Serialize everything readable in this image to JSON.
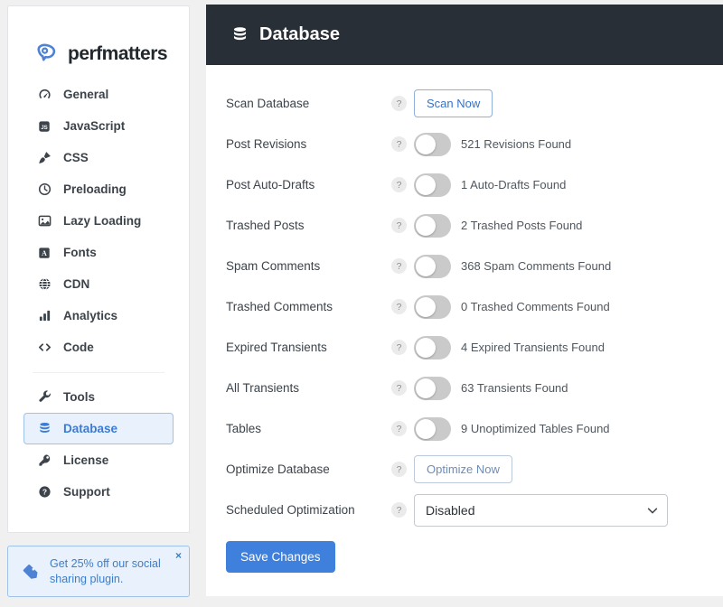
{
  "brand": {
    "name": "perfmatters"
  },
  "sidebar": {
    "items": [
      {
        "label": "General"
      },
      {
        "label": "JavaScript"
      },
      {
        "label": "CSS"
      },
      {
        "label": "Preloading"
      },
      {
        "label": "Lazy Loading"
      },
      {
        "label": "Fonts"
      },
      {
        "label": "CDN"
      },
      {
        "label": "Analytics"
      },
      {
        "label": "Code"
      }
    ],
    "items_secondary": [
      {
        "label": "Tools"
      },
      {
        "label": "Database",
        "active": true
      },
      {
        "label": "License"
      },
      {
        "label": "Support"
      }
    ],
    "promo": {
      "text": "Get 25% off our social sharing plugin.",
      "close": "×"
    }
  },
  "header": {
    "title": "Database"
  },
  "ui": {
    "help_glyph": "?"
  },
  "settings": {
    "rows": [
      {
        "label": "Scan Database",
        "control": "button",
        "button_label": "Scan Now"
      },
      {
        "label": "Post Revisions",
        "control": "toggle",
        "state": "off",
        "status": "521 Revisions Found"
      },
      {
        "label": "Post Auto-Drafts",
        "control": "toggle",
        "state": "off",
        "status": "1 Auto-Drafts Found"
      },
      {
        "label": "Trashed Posts",
        "control": "toggle",
        "state": "off",
        "status": "2 Trashed Posts Found"
      },
      {
        "label": "Spam Comments",
        "control": "toggle",
        "state": "off",
        "status": "368 Spam Comments Found"
      },
      {
        "label": "Trashed Comments",
        "control": "toggle",
        "state": "off",
        "status": "0 Trashed Comments Found"
      },
      {
        "label": "Expired Transients",
        "control": "toggle",
        "state": "off",
        "status": "4 Expired Transients Found"
      },
      {
        "label": "All Transients",
        "control": "toggle",
        "state": "off",
        "status": "63 Transients Found"
      },
      {
        "label": "Tables",
        "control": "toggle",
        "state": "off",
        "status": "9 Unoptimized Tables Found"
      },
      {
        "label": "Optimize Database",
        "control": "button",
        "button_label": "Optimize Now"
      },
      {
        "label": "Scheduled Optimization",
        "control": "select",
        "value": "Disabled"
      }
    ],
    "save_label": "Save Changes"
  },
  "colors": {
    "accent_blue": "#3a7bd5",
    "header_dark": "#292f36",
    "active_item_bg": "#e9f2fc",
    "active_item_border": "#9ec2e8",
    "toggle_off": "#cacaca",
    "save_button": "#3f80dd",
    "page_bg": "#f0f0f1"
  }
}
